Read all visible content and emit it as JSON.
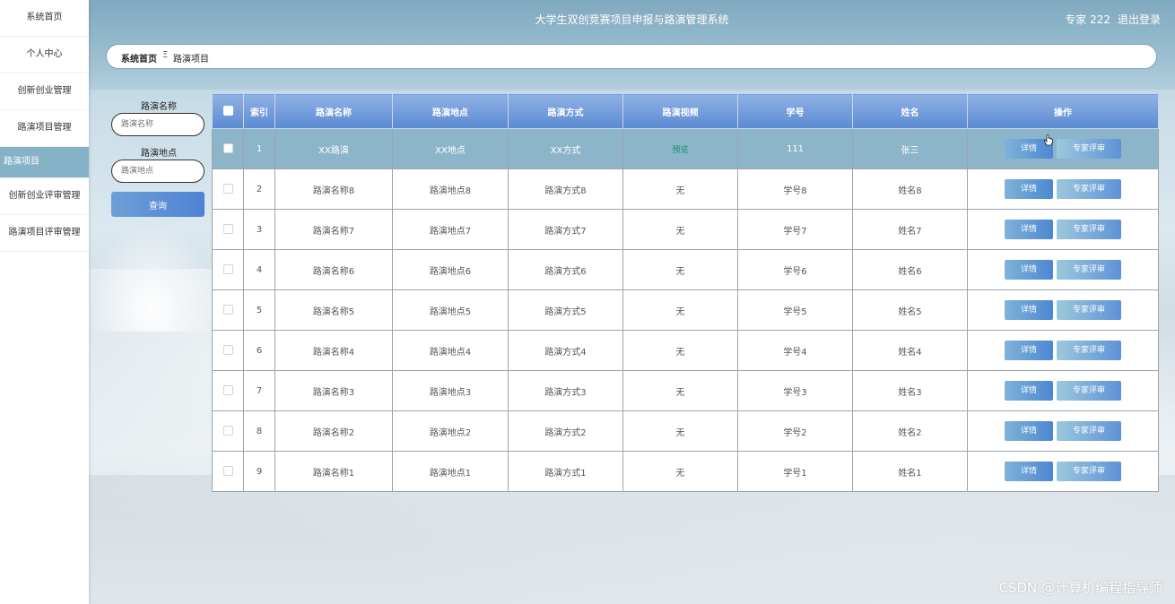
{
  "sidebar": {
    "items": [
      {
        "label": "系统首页"
      },
      {
        "label": "个人中心"
      },
      {
        "label": "创新创业管理"
      },
      {
        "label": "路演项目管理"
      },
      {
        "label": "路演项目"
      },
      {
        "label": "创新创业评审管理"
      },
      {
        "label": "路演项目评审管理"
      }
    ],
    "active_index": 4
  },
  "header": {
    "title": "大学生双创竞赛项目申报与路演管理系统",
    "user": "专家 222",
    "logout": "退出登录"
  },
  "breadcrumb": {
    "home": "系统首页",
    "separator": "Ξ",
    "current": "路演项目"
  },
  "search": {
    "name_label": "路演名称",
    "name_placeholder": "路演名称",
    "location_label": "路演地点",
    "location_placeholder": "路演地点",
    "button": "查询"
  },
  "table": {
    "headers": [
      "",
      "索引",
      "路演名称",
      "路演地点",
      "路演方式",
      "路演视频",
      "学号",
      "姓名",
      "操作"
    ],
    "rows": [
      {
        "index": "1",
        "name": "XX路演",
        "location": "XX地点",
        "method": "XX方式",
        "video": "预览",
        "student_no": "111",
        "student_name": "张三"
      },
      {
        "index": "2",
        "name": "路演名称8",
        "location": "路演地点8",
        "method": "路演方式8",
        "video": "无",
        "student_no": "学号8",
        "student_name": "姓名8"
      },
      {
        "index": "3",
        "name": "路演名称7",
        "location": "路演地点7",
        "method": "路演方式7",
        "video": "无",
        "student_no": "学号7",
        "student_name": "姓名7"
      },
      {
        "index": "4",
        "name": "路演名称6",
        "location": "路演地点6",
        "method": "路演方式6",
        "video": "无",
        "student_no": "学号6",
        "student_name": "姓名6"
      },
      {
        "index": "5",
        "name": "路演名称5",
        "location": "路演地点5",
        "method": "路演方式5",
        "video": "无",
        "student_no": "学号5",
        "student_name": "姓名5"
      },
      {
        "index": "6",
        "name": "路演名称4",
        "location": "路演地点4",
        "method": "路演方式4",
        "video": "无",
        "student_no": "学号4",
        "student_name": "姓名4"
      },
      {
        "index": "7",
        "name": "路演名称3",
        "location": "路演地点3",
        "method": "路演方式3",
        "video": "无",
        "student_no": "学号3",
        "student_name": "姓名3"
      },
      {
        "index": "8",
        "name": "路演名称2",
        "location": "路演地点2",
        "method": "路演方式2",
        "video": "无",
        "student_no": "学号2",
        "student_name": "姓名2"
      },
      {
        "index": "9",
        "name": "路演名称1",
        "location": "路演地点1",
        "method": "路演方式1",
        "video": "无",
        "student_no": "学号1",
        "student_name": "姓名1"
      }
    ],
    "detail_label": "详情",
    "review_label": "专家评审",
    "highlighted_row": 0
  },
  "watermark": "CSDN @计算机编程指导师",
  "colors": {
    "header_bg": "#86b2c8",
    "active_menu": "#86b2c8",
    "table_header": "#5b8ad2",
    "preview_link": "#198c6a"
  }
}
